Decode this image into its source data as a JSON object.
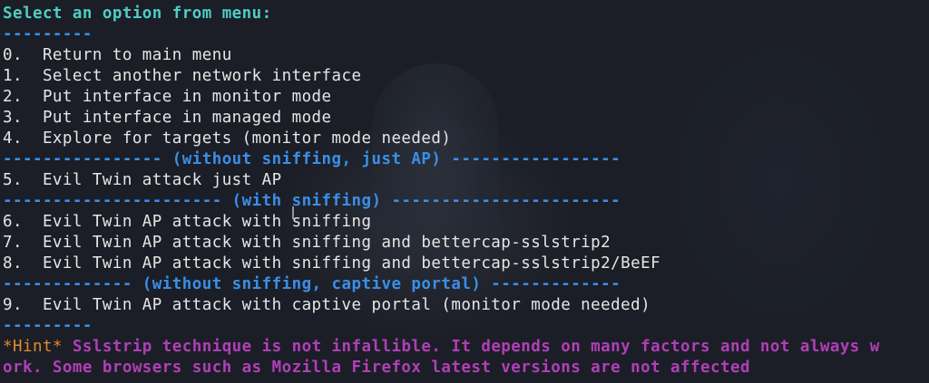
{
  "menu": {
    "title": "Select an option from menu:",
    "separator_top": "---------",
    "items": [
      "0.  Return to main menu",
      "1.  Select another network interface",
      "2.  Put interface in monitor mode",
      "3.  Put interface in managed mode",
      "4.  Explore for targets (monitor mode needed)"
    ],
    "section_no_sniffing": "---------------- (without sniffing, just AP) -----------------",
    "item_5": "5.  Evil Twin attack just AP",
    "section_with_sniffing": "---------------------- (with sniffing) -----------------------",
    "items_sniffing": [
      "6.  Evil Twin AP attack with sniffing",
      "7.  Evil Twin AP attack with sniffing and bettercap-sslstrip2",
      "8.  Evil Twin AP attack with sniffing and bettercap-sslstrip2/BeEF"
    ],
    "section_captive": "------------- (without sniffing, captive portal) -------------",
    "item_9": "9.  Evil Twin AP attack with captive portal (monitor mode needed)",
    "separator_bottom": "---------"
  },
  "hint": {
    "tag": "*Hint*",
    "line1": " Sslstrip technique is not infallible. It depends on many factors and not always w",
    "line2": "ork. Some browsers such as Mozilla Firefox latest versions are not affected"
  },
  "colors": {
    "title": "#4ecdc4",
    "separator": "#3a8fe8",
    "text": "#e6e6e6",
    "hint": "#b13fb8",
    "hint_tag": "#e08a2e"
  }
}
